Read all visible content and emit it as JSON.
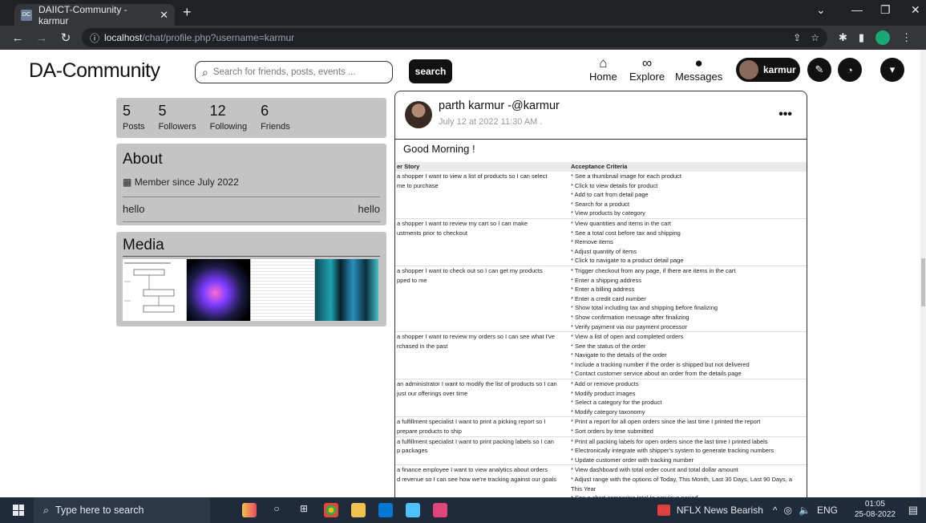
{
  "browser": {
    "tab_title": "DAIICT-Community - karmur",
    "tab_favicon_text": "DC",
    "url_host": "localhost",
    "url_path": "/chat/profile.php?username=karmur"
  },
  "header": {
    "brand": "DA-Community",
    "search_placeholder": "Search for friends, posts, events ...",
    "search_button": "search",
    "nav": [
      {
        "label": "Home",
        "icon": "home-icon"
      },
      {
        "label": "Explore",
        "icon": "binoculars-icon"
      },
      {
        "label": "Messages",
        "icon": "chat-icon"
      }
    ],
    "username": "karmur"
  },
  "profile": {
    "stats": [
      {
        "num": "5",
        "label": "Posts"
      },
      {
        "num": "5",
        "label": "Followers"
      },
      {
        "num": "12",
        "label": "Following"
      },
      {
        "num": "6",
        "label": "Friends"
      }
    ],
    "about_title": "About",
    "member_since": "Member since July 2022",
    "bio_left": "hello",
    "bio_right": "hello",
    "media_title": "Media"
  },
  "post": {
    "author": "parth karmur -@karmur",
    "date": "July 12 at 2022 11:30 AM .",
    "more": "•••",
    "text": "Good Morning !",
    "doc_header": [
      "er Story",
      "Acceptance Criteria"
    ],
    "doc_rows": [
      {
        "story": [
          "a shopper I want to view a list of products so I can select",
          "me to purchase",
          "",
          "",
          ""
        ],
        "criteria": [
          "* See a thumbnail image for each product",
          "* Click to view details for product",
          "* Add to cart from detail page",
          "* Search for a product",
          "* View products by category"
        ]
      },
      {
        "story": [
          "a shopper I want to review my cart so I can make",
          "ustments prior to checkout",
          "",
          "",
          ""
        ],
        "criteria": [
          "* View quantities and items in the cart",
          "* See a total cost before tax and shipping",
          "* Remove items",
          "* Adjust quantity of items",
          "* Click to navigate to a product detail page"
        ]
      },
      {
        "story": [
          "a shopper I want to check out so I can get my products",
          "pped to me",
          "",
          "",
          "",
          "",
          ""
        ],
        "criteria": [
          "* Trigger checkout from any page, if there are items in the cart",
          "* Enter a shipping address",
          "* Enter a billing address",
          "* Enter a credit card number",
          "* Show total including tax and shipping before finalizing",
          "* Show confirmation message after finalizing",
          "* Verify payment via our payment processor"
        ]
      },
      {
        "story": [
          "a shopper I want to review my orders so I can see what I've",
          "rchased in the past",
          "",
          "",
          ""
        ],
        "criteria": [
          "* View a list of open and completed orders",
          "* See the status of the order",
          "* Navigate to the details of the order",
          "* Include a tracking number if the order is shipped but not delivered",
          "* Contact customer service about an order from the details page"
        ]
      },
      {
        "story": [
          "an administrator I want to modify the list of products so I can",
          "just our offerings over time",
          "",
          ""
        ],
        "criteria": [
          "* Add or remove products",
          "* Modify product images",
          "* Select a category for the product",
          "* Modify category taxonomy"
        ]
      },
      {
        "story": [
          "a fulfillment specialist I want to print a picking report so I",
          "prepare products to ship"
        ],
        "criteria": [
          "* Print a report for all open orders since the last time I printed the report",
          "* Sort orders by time submitted"
        ]
      },
      {
        "story": [
          "a fulfillment specialist I want to print packing labels so I can",
          "p packages",
          ""
        ],
        "criteria": [
          "* Print all packing labels for open orders since the last time I printed labels",
          "* Electronically integrate with shipper's system to generate tracking numbers",
          "* Update customer order with tracking number"
        ]
      },
      {
        "story": [
          "a finance employee I want to view analytics about orders",
          "d revenue so I can see how we're tracking against our goals",
          "",
          ""
        ],
        "criteria": [
          "* View dashboard with total order count and total dollar amount",
          "* Adjust range with the options of Today, This Month, Last 30 Days, Last 90 Days, a",
          "This Year",
          "* See a chart comparing total to previous period"
        ]
      }
    ]
  },
  "taskbar": {
    "search_placeholder": "Type here to search",
    "news": "NFLX  News Bearish",
    "lang": "ENG",
    "time": "01:05",
    "date": "25-08-2022"
  }
}
